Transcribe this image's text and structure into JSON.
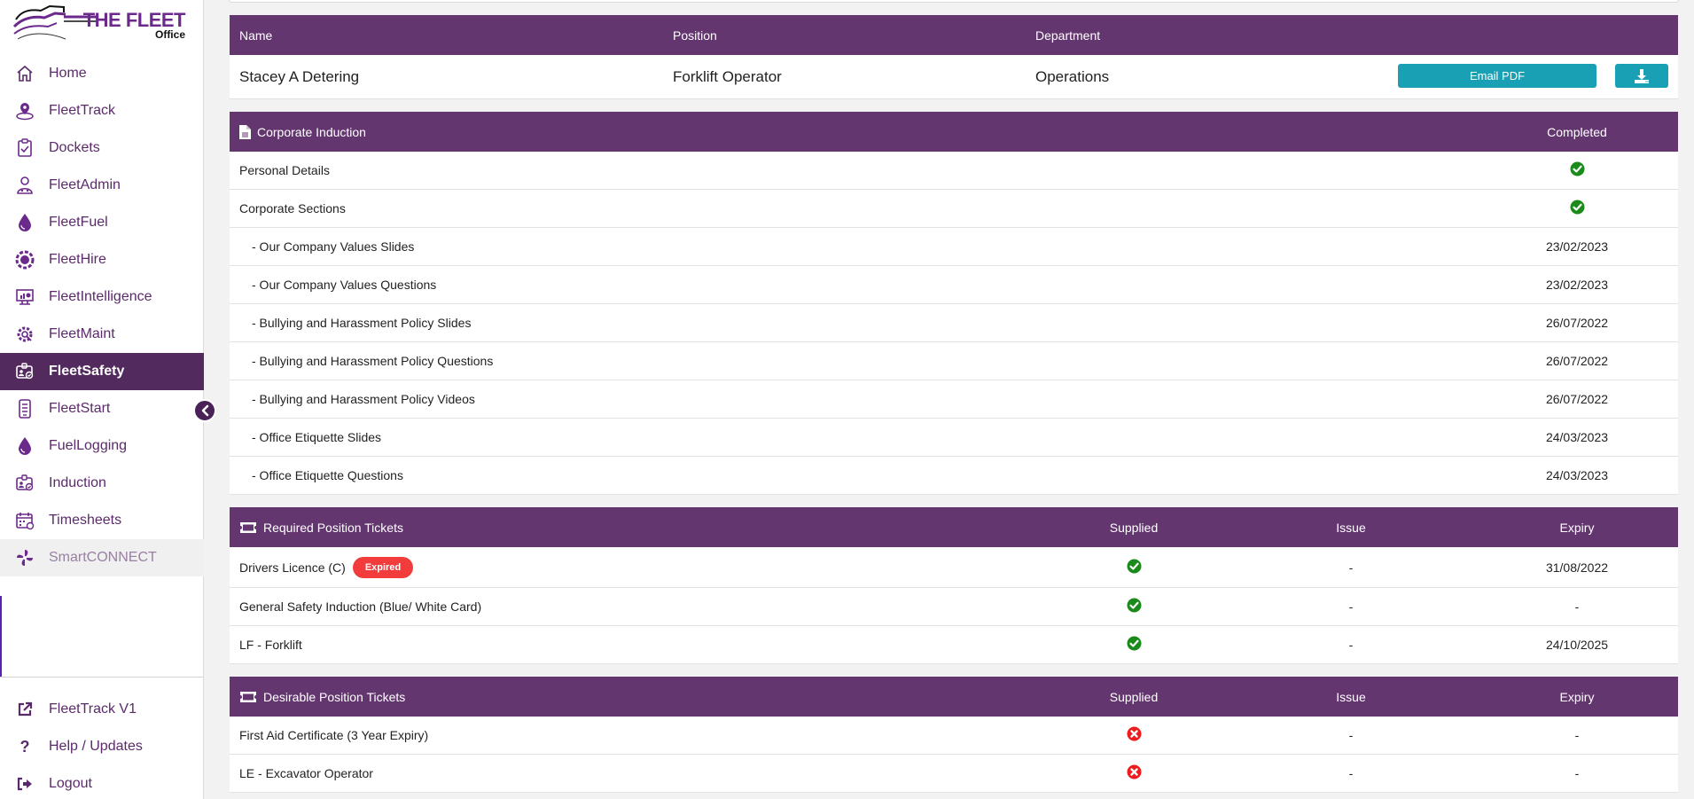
{
  "brand": {
    "name": "THE FLEET",
    "subtitle": "Office"
  },
  "colors": {
    "primary": "#643670",
    "active_nav": "#532a5e",
    "button": "#19a0b5",
    "success": "#1a8a1a",
    "danger": "#ee1c1c",
    "badge_expired": "#f23c3c"
  },
  "sidebar": {
    "items": [
      {
        "label": "Home",
        "icon": "home-icon"
      },
      {
        "label": "FleetTrack",
        "icon": "location-pin-icon"
      },
      {
        "label": "Dockets",
        "icon": "clipboard-check-icon"
      },
      {
        "label": "FleetAdmin",
        "icon": "user-admin-icon"
      },
      {
        "label": "FleetFuel",
        "icon": "fuel-drop-icon"
      },
      {
        "label": "FleetHire",
        "icon": "hire-badge-icon"
      },
      {
        "label": "FleetIntelligence",
        "icon": "monitor-chart-icon"
      },
      {
        "label": "FleetMaint",
        "icon": "gear-wrench-icon"
      },
      {
        "label": "FleetSafety",
        "icon": "id-badge-icon",
        "active": true
      },
      {
        "label": "FleetStart",
        "icon": "mobile-checklist-icon"
      },
      {
        "label": "FuelLogging",
        "icon": "fuel-drop-icon"
      },
      {
        "label": "Induction",
        "icon": "id-badge-icon"
      },
      {
        "label": "Timesheets",
        "icon": "calendar-clock-icon"
      },
      {
        "label": "SmartCONNECT",
        "icon": "pinwheel-icon",
        "disabled": true
      }
    ],
    "bottom_items": [
      {
        "label": "FleetTrack V1",
        "icon": "external-link-icon"
      },
      {
        "label": "Help / Updates",
        "icon": "question-icon"
      },
      {
        "label": "Logout",
        "icon": "logout-icon"
      }
    ]
  },
  "person": {
    "headers": {
      "name": "Name",
      "position": "Position",
      "department": "Department"
    },
    "name": "Stacey A Detering",
    "position": "Forklift Operator",
    "department": "Operations",
    "email_pdf_label": "Email PDF",
    "download_icon": "download-icon"
  },
  "corporate_induction": {
    "title": "Corporate Induction",
    "completed_header": "Completed",
    "rows": [
      {
        "label": "Personal Details",
        "status": "check"
      },
      {
        "label": "Corporate Sections",
        "status": "check"
      },
      {
        "label": "- Our Company Values Slides",
        "date": "23/02/2023",
        "sub": true
      },
      {
        "label": "- Our Company Values Questions",
        "date": "23/02/2023",
        "sub": true
      },
      {
        "label": "- Bullying and Harassment Policy Slides",
        "date": "26/07/2022",
        "sub": true
      },
      {
        "label": "- Bullying and Harassment Policy Questions",
        "date": "26/07/2022",
        "sub": true
      },
      {
        "label": "- Bullying and Harassment Policy Videos",
        "date": "26/07/2022",
        "sub": true
      },
      {
        "label": "- Office Etiquette Slides",
        "date": "24/03/2023",
        "sub": true
      },
      {
        "label": "- Office Etiquette Questions",
        "date": "24/03/2023",
        "sub": true
      }
    ]
  },
  "required_tickets": {
    "title": "Required Position Tickets",
    "headers": {
      "supplied": "Supplied",
      "issue": "Issue",
      "expiry": "Expiry"
    },
    "rows": [
      {
        "label": "Drivers Licence (C)",
        "badge": "Expired",
        "supplied": "check",
        "issue": "-",
        "expiry": "31/08/2022"
      },
      {
        "label": "General Safety Induction (Blue/ White Card)",
        "supplied": "check",
        "issue": "-",
        "expiry": "-"
      },
      {
        "label": "LF - Forklift",
        "supplied": "check",
        "issue": "-",
        "expiry": "24/10/2025"
      }
    ]
  },
  "desirable_tickets": {
    "title": "Desirable Position Tickets",
    "headers": {
      "supplied": "Supplied",
      "issue": "Issue",
      "expiry": "Expiry"
    },
    "rows": [
      {
        "label": "First Aid Certificate (3 Year Expiry)",
        "supplied": "cross",
        "issue": "-",
        "expiry": "-"
      },
      {
        "label": "LE - Excavator Operator",
        "supplied": "cross",
        "issue": "-",
        "expiry": "-"
      }
    ]
  }
}
